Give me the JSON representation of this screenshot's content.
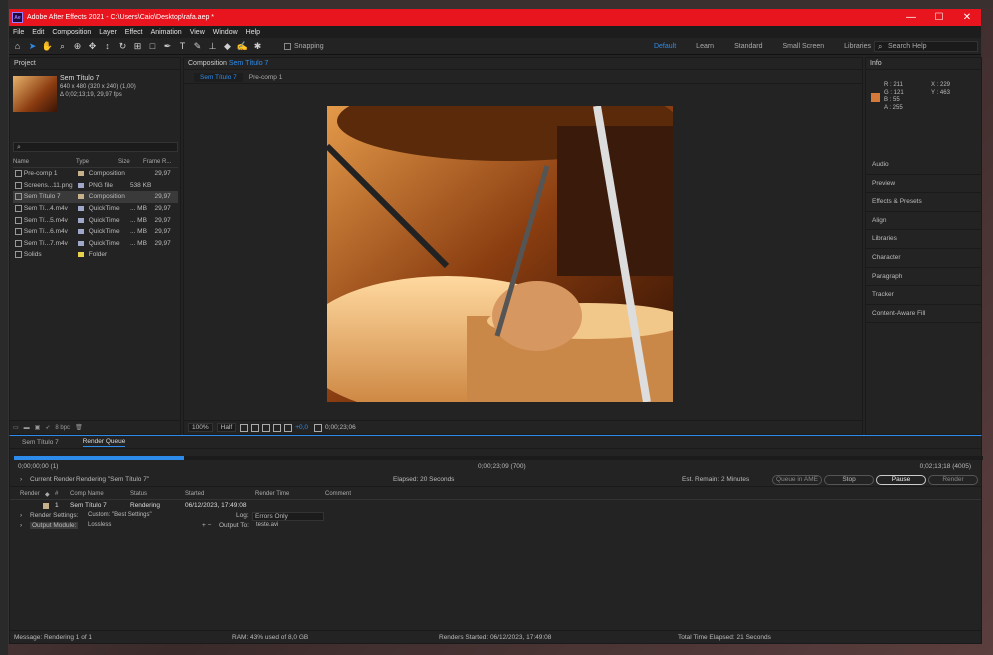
{
  "window": {
    "title": "Adobe After Effects 2021 - C:\\Users\\Caio\\Desktop\\rafa.aep *",
    "app_icon_text": "Ae",
    "controls": [
      "—",
      "☐",
      "✕"
    ]
  },
  "menu": [
    "File",
    "Edit",
    "Composition",
    "Layer",
    "Effect",
    "Animation",
    "View",
    "Window",
    "Help"
  ],
  "toolbar": {
    "snapping_label": "Snapping",
    "workspaces": [
      "Default",
      "Learn",
      "Standard",
      "Small Screen",
      "Libraries"
    ],
    "active_workspace": "Default",
    "search_placeholder": "Search Help"
  },
  "project": {
    "panel_title": "Project",
    "comp_name": "Sem Título 7",
    "comp_dims": "640 x 480  (320 x 240) (1,00)",
    "comp_duration": "Δ 0;02;13;19, 29,97 fps",
    "search_value": "",
    "columns": [
      "Name",
      "Type",
      "Size",
      "Frame R..."
    ],
    "items": [
      {
        "name": "Pre-comp 1",
        "type": "Composition",
        "size": "",
        "fps": "29,97",
        "label": "#c8b08a"
      },
      {
        "name": "Screens...11.png",
        "type": "PNG file",
        "size": "538 KB",
        "fps": "",
        "label": "#9fa8c9"
      },
      {
        "name": "Sem Título 7",
        "type": "Composition",
        "size": "",
        "fps": "29,97",
        "label": "#c8b08a"
      },
      {
        "name": "Sem Tí...4.m4v",
        "type": "QuickTime",
        "size": "... MB",
        "fps": "29,97",
        "label": "#9fa8c9"
      },
      {
        "name": "Sem Tí...5.m4v",
        "type": "QuickTime",
        "size": "... MB",
        "fps": "29,97",
        "label": "#9fa8c9"
      },
      {
        "name": "Sem Tí...6.m4v",
        "type": "QuickTime",
        "size": "... MB",
        "fps": "29,97",
        "label": "#9fa8c9"
      },
      {
        "name": "Sem Tí...7.m4v",
        "type": "QuickTime",
        "size": "... MB",
        "fps": "29,97",
        "label": "#9fa8c9"
      },
      {
        "name": "Solids",
        "type": "Folder",
        "size": "",
        "fps": "",
        "label": "#e8d24a"
      }
    ],
    "footer_bpc": "8 bpc"
  },
  "composition": {
    "panel_title": "Composition",
    "active_comp": "Sem Título 7",
    "tabs": [
      "Sem Título 7",
      "Pre-comp 1"
    ],
    "zoom": "100%",
    "resolution": "Half",
    "exposure": "+0,0",
    "timecode": "0;00;23;06"
  },
  "info": {
    "panel_title": "Info",
    "color_swatch": "#d37a3b",
    "r": "R : 211",
    "g": "G : 121",
    "b": "B : 55",
    "a": "A : 255",
    "x": "X : 229",
    "y": "Y : 463",
    "panels": [
      "Audio",
      "Preview",
      "Effects & Presets",
      "Align",
      "Libraries",
      "Character",
      "Paragraph",
      "Tracker",
      "Content-Aware Fill"
    ]
  },
  "render_queue": {
    "tabs": [
      "Sem Título 7",
      "Render Queue"
    ],
    "progress": 0.175,
    "time_start": "0;00;00;00 (1)",
    "time_current": "0;00;23;09 (700)",
    "time_end": "0;02;13;18 (4005)",
    "current_render_label": "Current Render",
    "rendering_text": "Rendering \"Sem Título 7\"",
    "elapsed": "Elapsed:  20 Seconds",
    "est_remain": "Est. Remain:  2 Minutes",
    "btn_queue_ame": "Queue in AME",
    "btn_stop": "Stop",
    "btn_pause": "Pause",
    "btn_render": "Render",
    "columns": [
      "Render",
      "#",
      "Comp Name",
      "Status",
      "Started",
      "Render Time",
      "Comment"
    ],
    "item": {
      "num": "1",
      "comp": "Sem Título 7",
      "status": "Rendering",
      "started": "06/12/2023, 17:49:08"
    },
    "render_settings_label": "Render Settings:",
    "render_settings_value": "Custom: \"Best Settings\"",
    "log_label": "Log:",
    "log_value": "Errors Only",
    "output_module_label": "Output Module:",
    "output_module_value": "Lossless",
    "output_to_label": "Output To:",
    "output_to_value": "teste.avi"
  },
  "statusbar": {
    "message": "Message:  Rendering 1 of 1",
    "ram": "RAM:  43% used of 8,0 GB",
    "renders_started": "Renders Started:  06/12/2023, 17:49:08",
    "total_elapsed": "Total Time Elapsed:  21 Seconds"
  }
}
